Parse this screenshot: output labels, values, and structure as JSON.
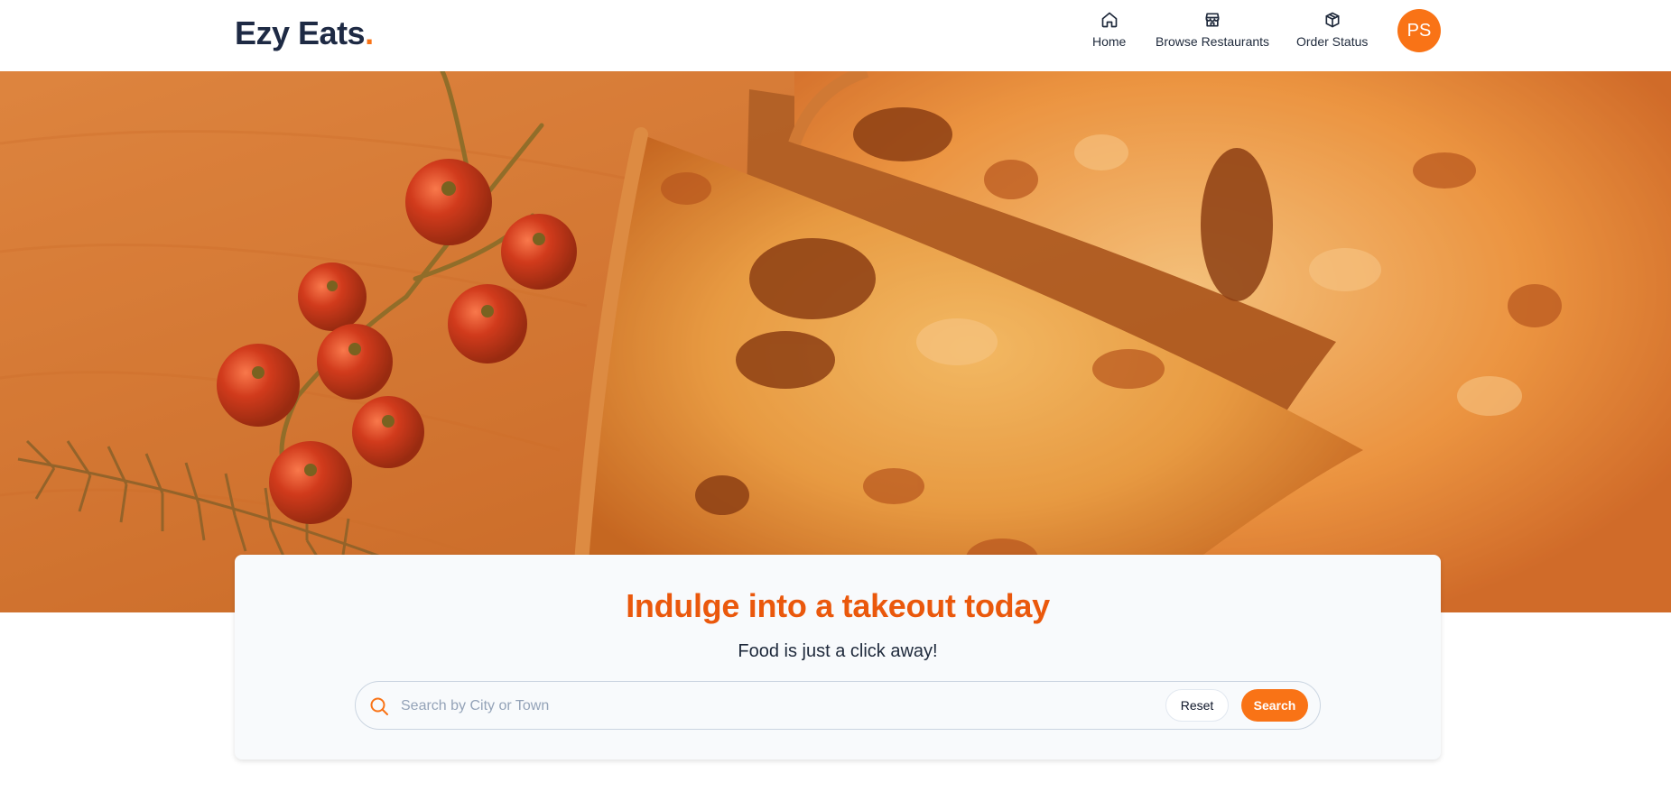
{
  "brand": {
    "name": "Ezy Eats",
    "dot": ".",
    "accent_color": "#f97316"
  },
  "nav": {
    "items": [
      {
        "label": "Home",
        "icon": "home-icon"
      },
      {
        "label": "Browse Restaurants",
        "icon": "store-icon"
      },
      {
        "label": "Order Status",
        "icon": "package-icon"
      }
    ]
  },
  "user": {
    "initials": "PS"
  },
  "hero": {
    "image": "pizza-with-cherry-tomatoes-and-rosemary"
  },
  "search_card": {
    "title": "Indulge into a takeout today",
    "subtitle": "Food is just a click away!",
    "input_placeholder": "Search by City or Town",
    "input_value": "",
    "reset_label": "Reset",
    "search_label": "Search"
  },
  "colors": {
    "title": "#ea580c",
    "primary_button": "#f97316",
    "text_dark": "#1e293b"
  }
}
